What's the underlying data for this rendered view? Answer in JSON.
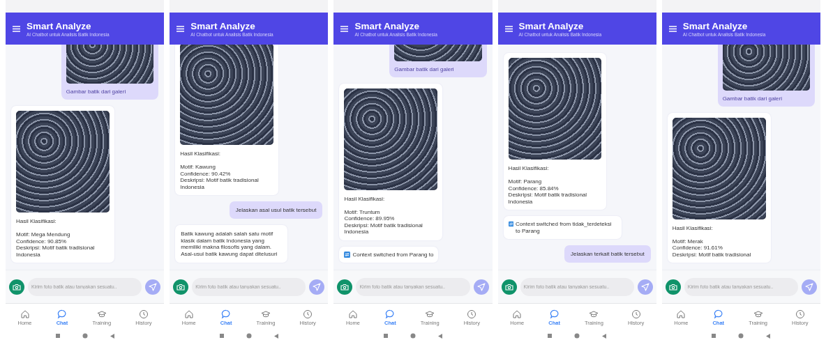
{
  "screens": [
    {
      "header": {
        "title": "Smart Analyze",
        "subtitle": "AI Chatbot untuk Analisis Batik Indonesia"
      },
      "messages": [
        {
          "kind": "user_image",
          "caption": "Gambar batik dari galeri"
        },
        {
          "kind": "bot_result",
          "text": "Hasil Klasifikasi:\n\nMotif: Mega Mendung\nConfidence: 90.85%\nDeskripsi: Motif batik tradisional Indonesia"
        }
      ],
      "input": {
        "placeholder": "Kirim foto batik atau tanyakan sesuatu.."
      },
      "nav": [
        {
          "label": "Home",
          "selected": false
        },
        {
          "label": "Chat",
          "selected": true
        },
        {
          "label": "Training",
          "selected": false
        },
        {
          "label": "History",
          "selected": false
        }
      ]
    },
    {
      "header": {
        "title": "Smart Analyze",
        "subtitle": "AI Chatbot untuk Analisis Batik Indonesia"
      },
      "messages": [
        {
          "kind": "bot_result",
          "text": "Hasil Klasifikasi:\n\nMotif: Kawung\nConfidence: 90.42%\nDeskripsi: Motif batik tradisional Indonesia"
        },
        {
          "kind": "user_text",
          "text": "Jelaskan asal usul batik tersebut"
        },
        {
          "kind": "bot_text",
          "text": "Batik kawung adalah salah satu motif klasik dalam batik Indonesia yang memiliki makna filosofis yang dalam. Asal-usul batik kawung dapat ditelusuri"
        }
      ],
      "input": {
        "placeholder": "Kirim foto batik atau tanyakan sesuatu.."
      },
      "nav": [
        {
          "label": "Home",
          "selected": false
        },
        {
          "label": "Chat",
          "selected": true
        },
        {
          "label": "Training",
          "selected": false
        },
        {
          "label": "History",
          "selected": false
        }
      ]
    },
    {
      "header": {
        "title": "Smart Analyze",
        "subtitle": "AI Chatbot untuk Analisis Batik Indonesia"
      },
      "messages": [
        {
          "kind": "user_image",
          "caption": "Gambar batik dari galeri"
        },
        {
          "kind": "bot_result",
          "text": "Hasil Klasifikasi:\n\nMotif: Truntum\nConfidence: 89.95%\nDeskripsi: Motif batik tradisional Indonesia"
        },
        {
          "kind": "context",
          "text": "Context switched from Parang to"
        }
      ],
      "input": {
        "placeholder": "Kirim foto batik atau tanyakan sesuatu.."
      },
      "nav": [
        {
          "label": "Home",
          "selected": false
        },
        {
          "label": "Chat",
          "selected": true
        },
        {
          "label": "Training",
          "selected": false
        },
        {
          "label": "History",
          "selected": false
        }
      ]
    },
    {
      "header": {
        "title": "Smart Analyze",
        "subtitle": "AI Chatbot untuk Analisis Batik Indonesia"
      },
      "messages": [
        {
          "kind": "bot_result",
          "text": "Hasil Klasifikasi:\n\nMotif: Parang\nConfidence: 85.84%\nDeskripsi: Motif batik tradisional Indonesia"
        },
        {
          "kind": "context",
          "text": "Context switched from tidak_terdeteksi to Parang"
        },
        {
          "kind": "user_text",
          "text": "Jelaskan terkait batik tersebut"
        }
      ],
      "input": {
        "placeholder": "Kirim foto batik atau tanyakan sesuatu.."
      },
      "nav": [
        {
          "label": "Home",
          "selected": false
        },
        {
          "label": "Chat",
          "selected": true
        },
        {
          "label": "Training",
          "selected": false
        },
        {
          "label": "History",
          "selected": false
        }
      ]
    },
    {
      "header": {
        "title": "Smart Analyze",
        "subtitle": "AI Chatbot untuk Analisis Batik Indonesia"
      },
      "messages": [
        {
          "kind": "user_image",
          "caption": "Gambar batik dari galeri"
        },
        {
          "kind": "bot_result",
          "text": "Hasil Klasifikasi:\n\nMotif: Merak\nConfidence: 91.61%\nDeskripsi: Motif batik tradisional"
        }
      ],
      "input": {
        "placeholder": "Kirim foto batik atau tanyakan sesuatu.."
      },
      "nav": [
        {
          "label": "Home",
          "selected": false
        },
        {
          "label": "Chat",
          "selected": true
        },
        {
          "label": "Training",
          "selected": false
        },
        {
          "label": "History",
          "selected": false
        }
      ]
    }
  ]
}
